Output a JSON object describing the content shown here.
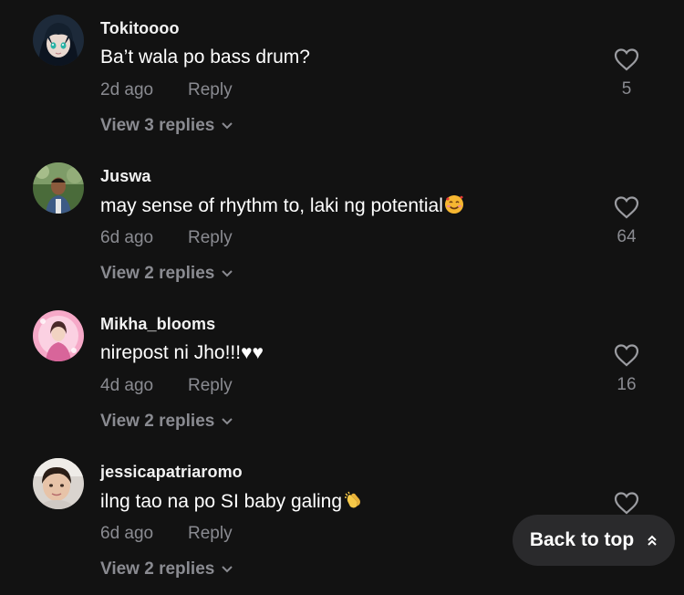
{
  "colors": {
    "background": "#121212",
    "primary_text": "#ffffff",
    "secondary_text": "#8a8b91",
    "button_bg": "#2a2a2c"
  },
  "comments": [
    {
      "username": "Tokitoooo",
      "text": "Ba’t wala po bass drum?",
      "time": "2d ago",
      "reply_label": "Reply",
      "like_count": "5",
      "view_replies": "View 3 replies",
      "avatar_icon": "anime-avatar"
    },
    {
      "username": "Juswa",
      "text": "may sense of rhythm to, laki ng potential",
      "emoji": "smiling-face-with-hearts",
      "time": "6d ago",
      "reply_label": "Reply",
      "like_count": "64",
      "view_replies": "View 2 replies",
      "avatar_icon": "photo-avatar"
    },
    {
      "username": "Mikha_blooms",
      "text": "nirepost ni Jho!!!♥♥",
      "time": "4d ago",
      "reply_label": "Reply",
      "like_count": "16",
      "view_replies": "View 2 replies",
      "avatar_icon": "pink-avatar"
    },
    {
      "username": "jessicapatriaromo",
      "text": "ilng tao na po SI baby galing",
      "emoji": "clapping-hands",
      "time": "6d ago",
      "reply_label": "Reply",
      "like_count": "",
      "view_replies": "View 2 replies",
      "avatar_icon": "photo-avatar"
    }
  ],
  "back_to_top": {
    "label": "Back to top"
  }
}
